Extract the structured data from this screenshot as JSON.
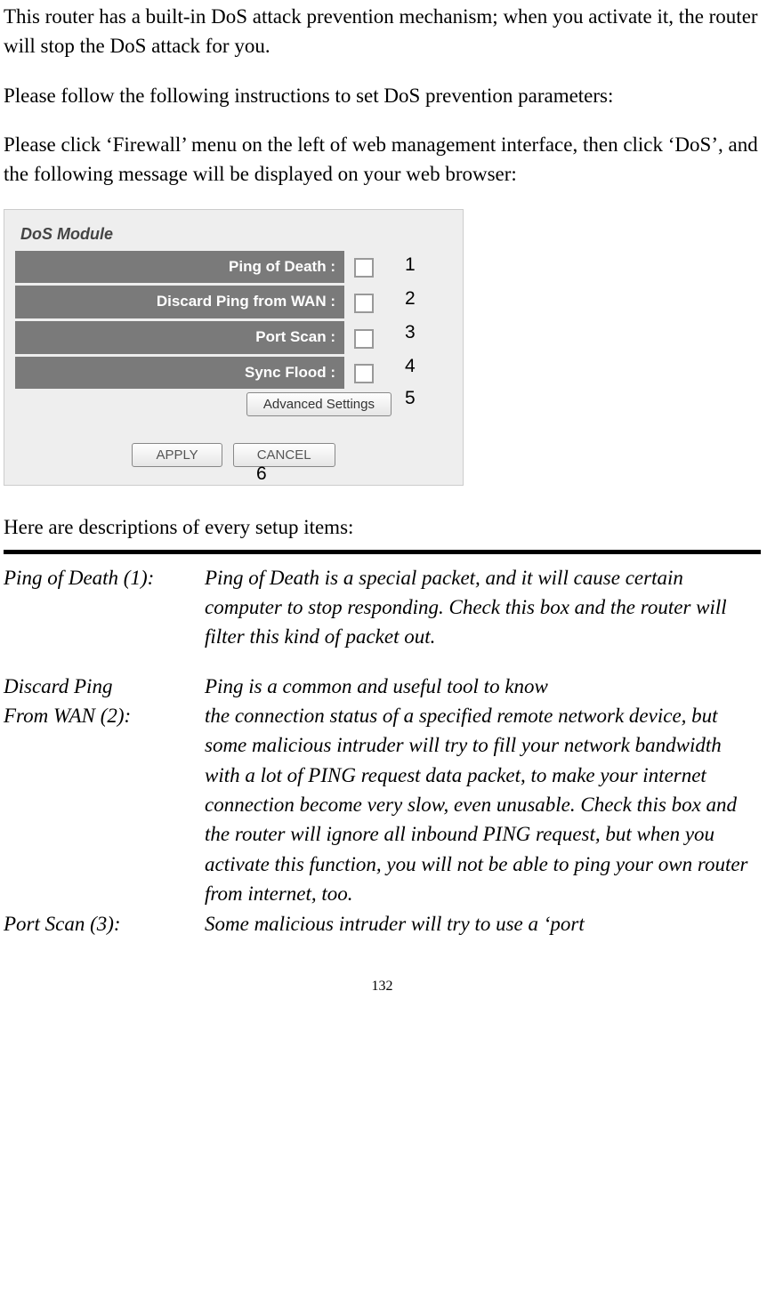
{
  "intro": {
    "p1": "This router has a built-in DoS attack prevention mechanism; when you activate it, the router will stop the DoS attack for you.",
    "p2": "Please follow the following instructions to set DoS prevention parameters:",
    "p3": "Please click ‘Firewall’ menu on the left of web management interface, then click ‘DoS’, and the following message will be displayed on your web browser:"
  },
  "panel": {
    "title": "DoS Module",
    "rows": [
      {
        "label": "Ping of Death :"
      },
      {
        "label": "Discard Ping from WAN :"
      },
      {
        "label": "Port Scan :"
      },
      {
        "label": "Sync Flood :"
      }
    ],
    "advanced_btn": "Advanced Settings",
    "apply_btn": "APPLY",
    "cancel_btn": "CANCEL"
  },
  "callouts": {
    "n1": "1",
    "n2": "2",
    "n3": "3",
    "n4": "4",
    "n5": "5",
    "n6": "6"
  },
  "descriptions_heading": "Here are descriptions of every setup items:",
  "definitions": [
    {
      "name": "Ping of Death (1):",
      "desc": "Ping of Death is a special packet, and it will cause certain computer to stop responding. Check this box and the router will filter this kind of packet out."
    },
    {
      "name_line1": "Discard Ping",
      "name_line2": "From WAN (2):",
      "desc_line1": "Ping is a common and useful tool to know",
      "desc_rest": "the connection status of a specified remote network device, but some malicious intruder will try to fill your network bandwidth with a lot of PING request data packet, to make your internet connection become very slow, even unusable. Check this box and the router will ignore all inbound PING request, but when you activate this function, you will not be able to ping your own router from internet, too."
    },
    {
      "name": "Port Scan (3):",
      "desc": "Some malicious intruder will try to use a ‘port"
    }
  ],
  "page_number": "132"
}
